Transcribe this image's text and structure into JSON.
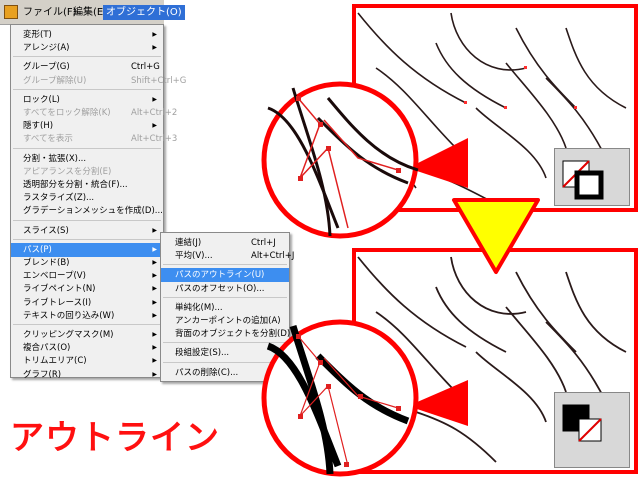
{
  "menubar": {
    "items": [
      {
        "label": "ファイル(F)"
      },
      {
        "label": "編集(E)"
      },
      {
        "label": "オブジェクト(O)"
      }
    ]
  },
  "object_menu": {
    "items": [
      {
        "label": "変形(T)",
        "shortcut": "",
        "sub": true,
        "disabled": false
      },
      {
        "label": "アレンジ(A)",
        "shortcut": "",
        "sub": true,
        "disabled": false
      },
      {
        "label": "グループ(G)",
        "shortcut": "Ctrl+G",
        "sub": false,
        "disabled": false
      },
      {
        "label": "グループ解除(U)",
        "shortcut": "Shift+Ctrl+G",
        "sub": false,
        "disabled": true
      },
      {
        "label": "ロック(L)",
        "shortcut": "",
        "sub": true,
        "disabled": false
      },
      {
        "label": "すべてをロック解除(K)",
        "shortcut": "Alt+Ctrl+2",
        "sub": false,
        "disabled": true
      },
      {
        "label": "隠す(H)",
        "shortcut": "",
        "sub": true,
        "disabled": false
      },
      {
        "label": "すべてを表示",
        "shortcut": "Alt+Ctrl+3",
        "sub": false,
        "disabled": true
      },
      {
        "label": "分割・拡張(X)...",
        "shortcut": "",
        "sub": false,
        "disabled": false
      },
      {
        "label": "アピアランスを分割(E)",
        "shortcut": "",
        "sub": false,
        "disabled": true
      },
      {
        "label": "透明部分を分割・統合(F)...",
        "shortcut": "",
        "sub": false,
        "disabled": false
      },
      {
        "label": "ラスタライズ(Z)...",
        "shortcut": "",
        "sub": false,
        "disabled": false
      },
      {
        "label": "グラデーションメッシュを作成(D)...",
        "shortcut": "",
        "sub": false,
        "disabled": false
      },
      {
        "label": "スライス(S)",
        "shortcut": "",
        "sub": true,
        "disabled": false
      },
      {
        "label": "パス(P)",
        "shortcut": "",
        "sub": true,
        "disabled": false,
        "highlighted": true
      },
      {
        "label": "ブレンド(B)",
        "shortcut": "",
        "sub": true,
        "disabled": false
      },
      {
        "label": "エンベロープ(V)",
        "shortcut": "",
        "sub": true,
        "disabled": false
      },
      {
        "label": "ライブペイント(N)",
        "shortcut": "",
        "sub": true,
        "disabled": false
      },
      {
        "label": "ライブトレース(I)",
        "shortcut": "",
        "sub": true,
        "disabled": false
      },
      {
        "label": "テキストの回り込み(W)",
        "shortcut": "",
        "sub": true,
        "disabled": false
      },
      {
        "label": "クリッピングマスク(M)",
        "shortcut": "",
        "sub": true,
        "disabled": false
      },
      {
        "label": "複合パス(O)",
        "shortcut": "",
        "sub": true,
        "disabled": false
      },
      {
        "label": "トリムエリア(C)",
        "shortcut": "",
        "sub": true,
        "disabled": false
      },
      {
        "label": "グラフ(R)",
        "shortcut": "",
        "sub": true,
        "disabled": false
      }
    ]
  },
  "path_submenu": {
    "items": [
      {
        "label": "連結(J)",
        "shortcut": "Ctrl+J"
      },
      {
        "label": "平均(V)...",
        "shortcut": "Alt+Ctrl+J"
      },
      {
        "label": "パスのアウトライン(U)",
        "shortcut": "",
        "highlighted": true
      },
      {
        "label": "パスのオフセット(O)...",
        "shortcut": ""
      },
      {
        "label": "単純化(M)...",
        "shortcut": ""
      },
      {
        "label": "アンカーポイントの追加(A)",
        "shortcut": ""
      },
      {
        "label": "背面のオブジェクトを分割(D)",
        "shortcut": ""
      },
      {
        "label": "段組設定(S)...",
        "shortcut": ""
      },
      {
        "label": "パスの削除(C)...",
        "shortcut": ""
      }
    ]
  },
  "caption": "アウトライン",
  "colors": {
    "accent_red": "#ff0000",
    "highlight_blue": "#3d8ef0",
    "arrow_yellow": "#ffff00"
  },
  "icons": {
    "fill_stroke_top": "stroke-swatch-icon",
    "fill_stroke_bottom": "fill-swatch-icon",
    "down_arrow": "down-arrow-icon"
  }
}
